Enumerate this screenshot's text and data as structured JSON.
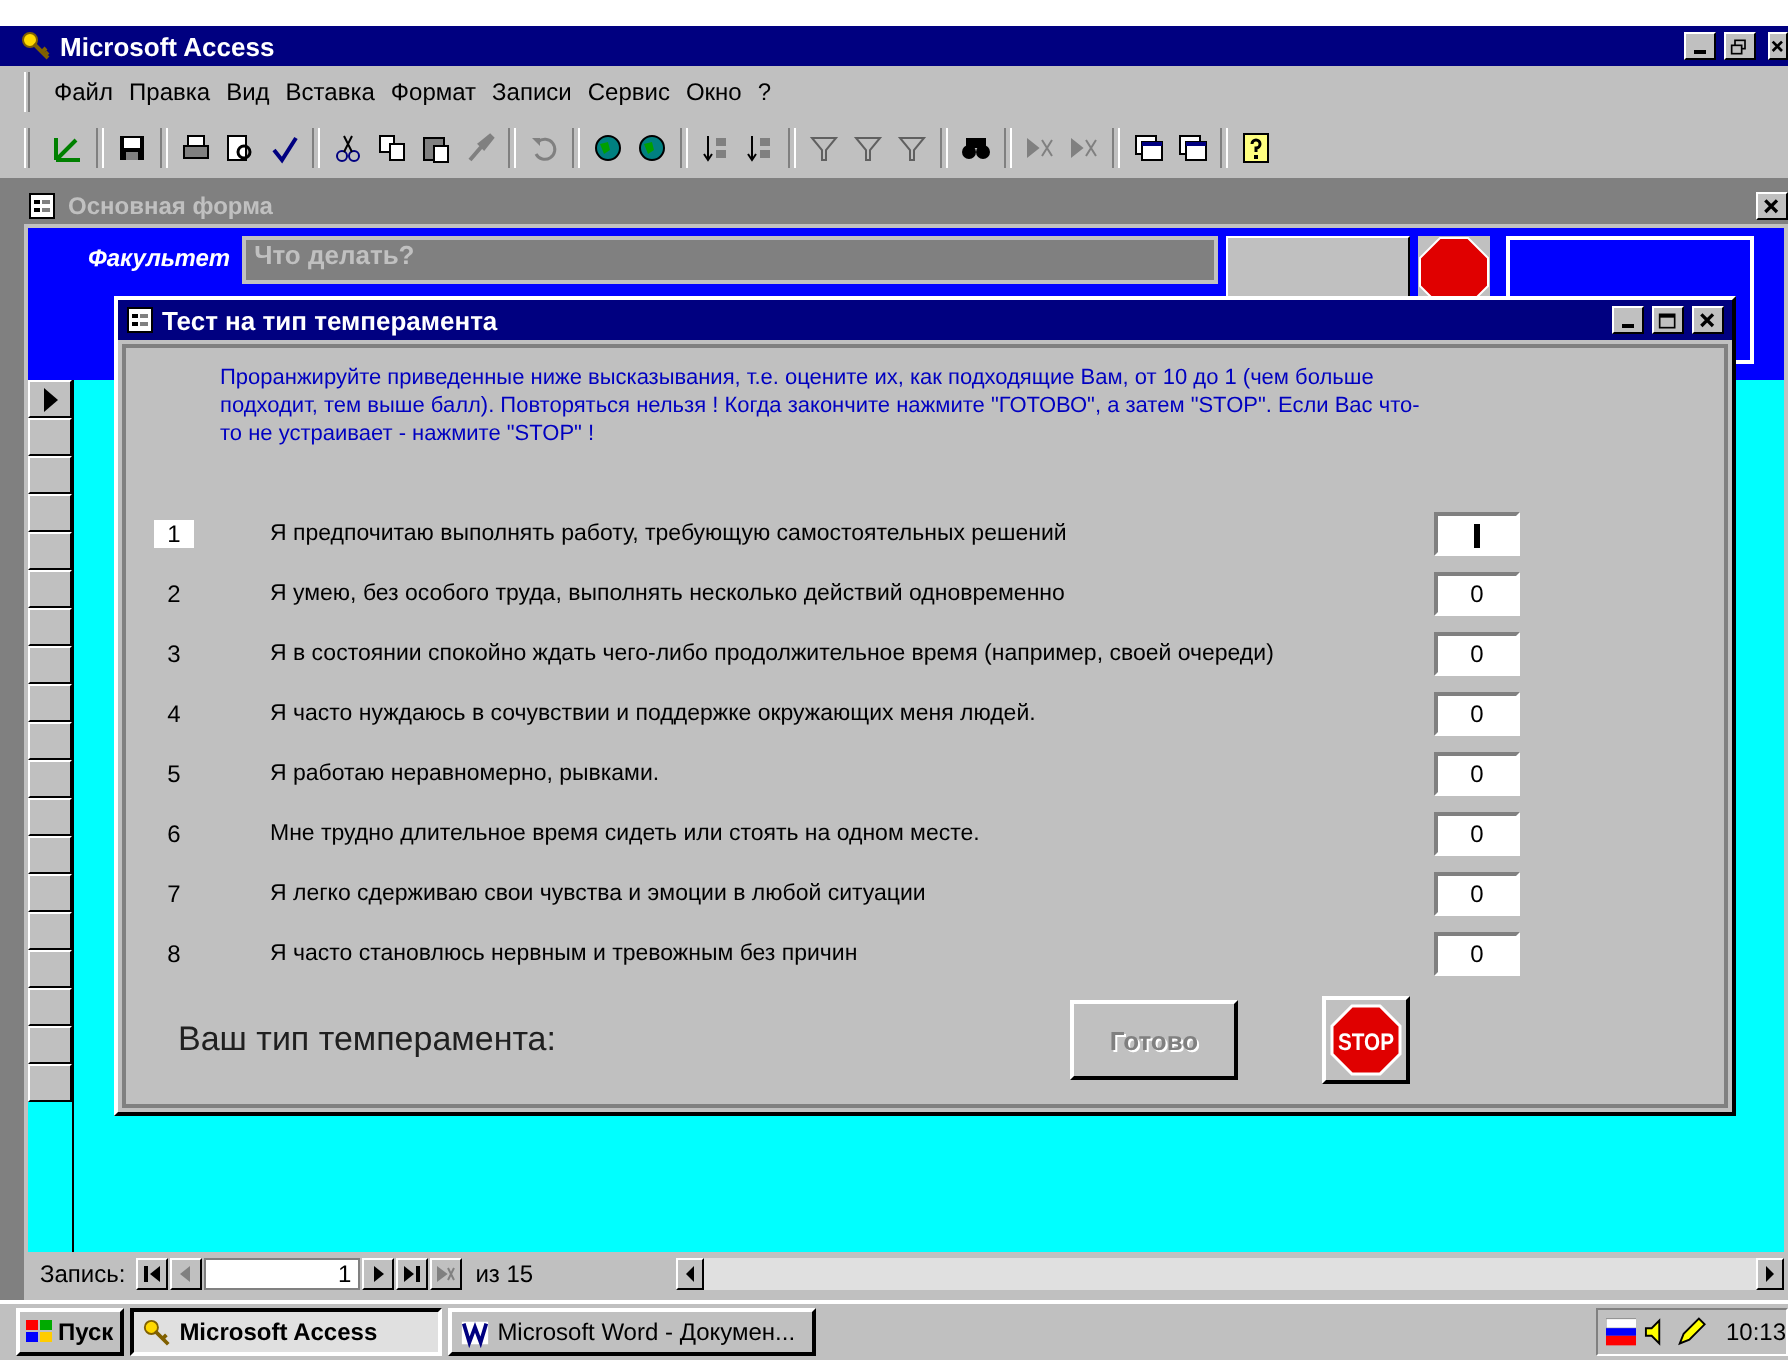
{
  "app_window": {
    "title": "Microsoft Access"
  },
  "menu": [
    "Файл",
    "Правка",
    "Вид",
    "Вставка",
    "Формат",
    "Записи",
    "Сервис",
    "Окно",
    "?"
  ],
  "form_window": {
    "title": "Основная форма",
    "faculty_label": "Факультет",
    "action_field": {
      "value": "Что делать?"
    }
  },
  "dialog": {
    "title": "Тест на тип темперамента",
    "instructions": "Проранжируйте приведенные ниже высказывания, т.е. оцените их, как подходящие Вам, от 10 до 1 (чем больше подходит, тем выше балл). Повторяться нельзя ! Когда закончите нажмите \"ГОТОВО\", а затем \"STOP\".  Если Вас что-то не устраивает - нажмите \"STOP\" !",
    "questions": [
      {
        "number": "1",
        "text": "Я предпочитаю выполнять работу, требующую самостоятельных решений",
        "selected": true
      },
      {
        "number": "2",
        "text": "Я умею, без особого труда, выполнять несколько действий одновременно",
        "value": "0",
        "selected": false
      },
      {
        "number": "3",
        "text": "Я в состоянии спокойно ждать чего-либо продолжительное время (например, своей очереди)",
        "value": "0",
        "selected": false
      },
      {
        "number": "4",
        "text": "Я часто нуждаюсь в сочувствии и поддержке окружающих меня людей.",
        "value": "0",
        "selected": false
      },
      {
        "number": "5",
        "text": "Я работаю неравномерно, рывками.",
        "value": "0",
        "selected": false
      },
      {
        "number": "6",
        "text": "Мне трудно длительное время сидеть или стоять на одном месте.",
        "value": "0",
        "selected": false
      },
      {
        "number": "7",
        "text": "Я легко сдерживаю свои чувства и эмоции в любой ситуации",
        "value": "0",
        "selected": false
      },
      {
        "number": "8",
        "text": "Я часто становлюсь нервным и тревожным без причин",
        "value": "0",
        "selected": false
      }
    ],
    "result_label": "Ваш тип темперамента:",
    "done_button": {
      "label": "Готово",
      "disabled": true
    },
    "stop_button": {
      "label": "STOP"
    }
  },
  "record_nav": {
    "label": "Запись:",
    "current": "1",
    "total": "из  15"
  },
  "taskbar": {
    "start": "Пуск",
    "tasks": [
      {
        "label": "Microsoft Access",
        "selected": true
      },
      {
        "label": "Microsoft Word - Докумен...",
        "selected": false
      }
    ],
    "clock": "10:13"
  }
}
